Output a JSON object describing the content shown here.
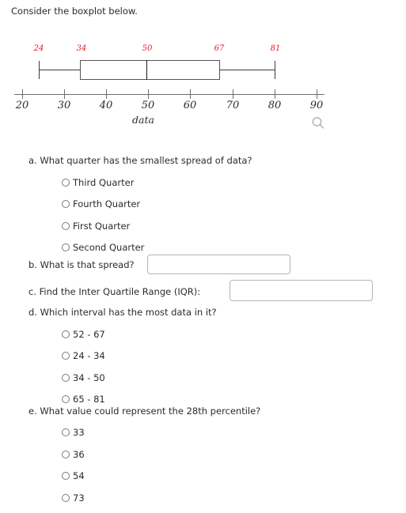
{
  "prompt": "Consider the boxplot below.",
  "chart_data": {
    "type": "boxplot",
    "title": "",
    "xlabel": "data",
    "ylabel": "",
    "xlim": [
      20,
      90
    ],
    "grid": false,
    "legend": null,
    "orientation": "horizontal",
    "tick_labels": [
      "20",
      "30",
      "40",
      "50",
      "60",
      "70",
      "80",
      "90"
    ],
    "ticks": [
      20,
      30,
      40,
      50,
      60,
      70,
      80,
      90
    ],
    "boxes": [
      {
        "min": 24,
        "q1": 34,
        "median": 50,
        "q3": 67,
        "max": 81,
        "value_labels": [
          "24",
          "34",
          "50",
          "67",
          "81"
        ],
        "value_label_color": "#e8192c"
      }
    ]
  },
  "figure": {
    "axis_title": "data",
    "zoom_icon": "magnifier-icon"
  },
  "questions": [
    {
      "id": "a",
      "text": "a. What quarter has the smallest spread of data?",
      "type": "radio",
      "options": [
        "Third Quarter",
        "Fourth Quarter",
        "First Quarter",
        "Second Quarter"
      ]
    },
    {
      "id": "b",
      "text": "b. What is that spread?",
      "type": "text",
      "value": "",
      "placeholder": ""
    },
    {
      "id": "c",
      "text": "c. Find the Inter Quartile Range (IQR):",
      "type": "text",
      "value": "",
      "placeholder": ""
    },
    {
      "id": "d",
      "text": "d. Which interval has the most data in it?",
      "type": "radio",
      "options": [
        "52 - 67",
        "24 - 34",
        "34 - 50",
        "65 - 81"
      ]
    },
    {
      "id": "e",
      "text": "e. What value could represent the 28th percentile?",
      "type": "radio",
      "options": [
        "33",
        "36",
        "54",
        "73"
      ]
    }
  ]
}
